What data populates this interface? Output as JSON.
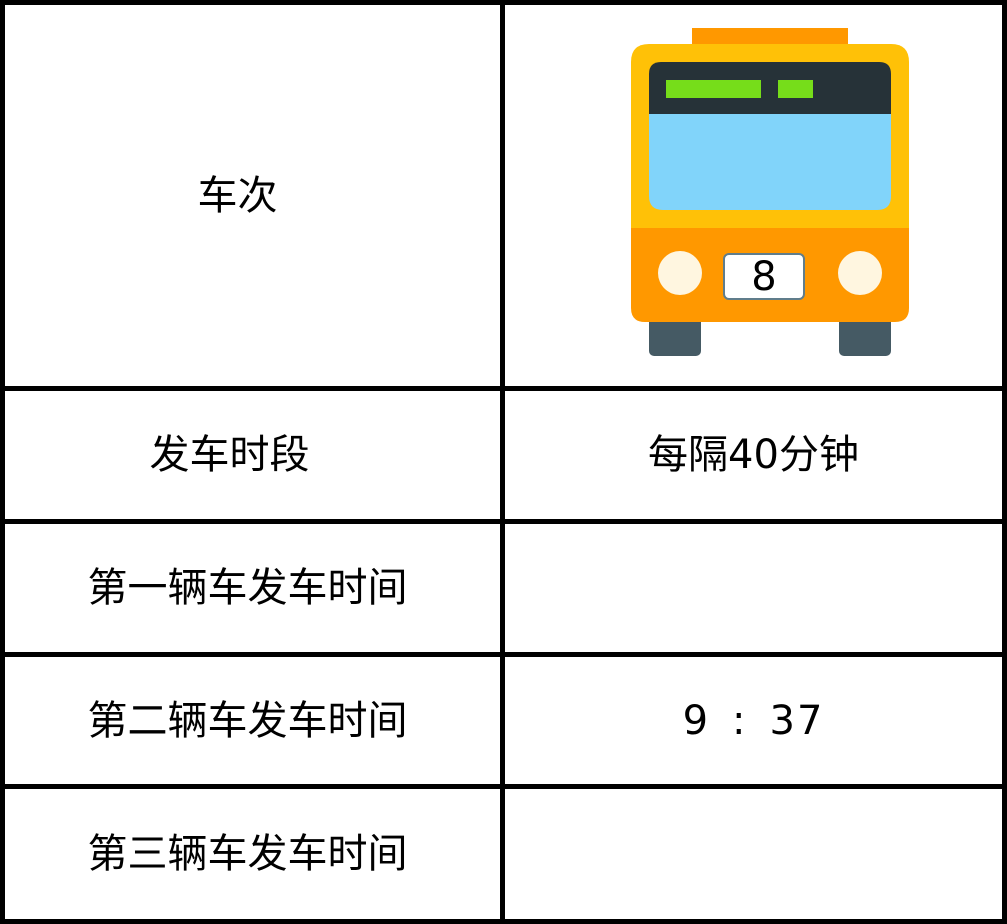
{
  "table": {
    "rows": [
      {
        "label": "车次",
        "value": ""
      },
      {
        "label": "发车时段",
        "value": "每隔40分钟"
      },
      {
        "label": "第一辆车发车时间",
        "value": ""
      },
      {
        "label": "第二辆车发车时间",
        "value": {
          "hour": "9",
          "separator": ":",
          "minute": "37"
        }
      },
      {
        "label": "第三辆车发车时间",
        "value": ""
      }
    ]
  },
  "bus_icon": {
    "route_number": "8",
    "colors": {
      "body_top": "#FFC107",
      "body_bottom": "#FF9800",
      "roof_sign": "#FF9800",
      "header_strip": "#263238",
      "windshield": "#81D4FA",
      "led_text": "#76DD1A",
      "headlights": "#FFF6E0",
      "wheels": "#455A64",
      "plate": "#FFFFFF"
    }
  }
}
